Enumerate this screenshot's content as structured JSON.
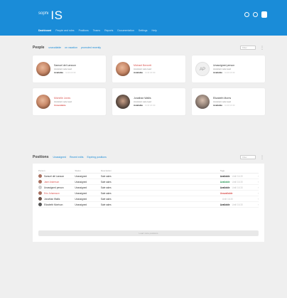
{
  "app": {
    "brand_prefix": "sophi",
    "brand_name": "IS"
  },
  "nav": [
    {
      "label": "Dashboard",
      "active": true
    },
    {
      "label": "People and roles",
      "active": false
    },
    {
      "label": "Positions",
      "active": false
    },
    {
      "label": "Teams",
      "active": false
    },
    {
      "label": "Reports",
      "active": false
    },
    {
      "label": "Documentation",
      "active": false
    },
    {
      "label": "Settings",
      "active": false
    },
    {
      "label": "Help",
      "active": false
    }
  ],
  "people": {
    "title": "People",
    "filters": [
      "unavailable",
      "on vacation",
      "promoted recently"
    ],
    "search_placeholder": "Filter",
    "more": "⋮",
    "cards": [
      {
        "name": "Samuel del Larsson",
        "sub": "Assistant sale lead",
        "status": "Available",
        "status_light": "Until 16:30",
        "pic": "photo",
        "name_color": "normal"
      },
      {
        "name": "Michael Bennett",
        "sub": "Assistant sale lead",
        "status": "Available",
        "status_light": "Until 16:30",
        "pic": "photo",
        "name_color": "red"
      },
      {
        "name": "Unassigned person",
        "sub": "Assistant sale lead",
        "status": "Available",
        "status_light": "Until 16:30",
        "pic": "initials",
        "initials": "AP",
        "name_color": "normal"
      },
      {
        "name": "Michelle Jones",
        "sub": "Assistant sale lead",
        "status": "Unavailable",
        "status_light": "",
        "pic": "photo",
        "name_color": "red",
        "status_color": "red"
      },
      {
        "name": "Jonathan Wallis",
        "sub": "Assistant sale lead",
        "status": "Available",
        "status_light": "Until 16:30",
        "pic": "photo-dark",
        "name_color": "normal"
      },
      {
        "name": "Elizabeth Morris",
        "sub": "Assistant sale lead",
        "status": "Available",
        "status_light": "Until 16:30",
        "pic": "photo-gray",
        "name_color": "normal"
      }
    ]
  },
  "positions": {
    "title": "Positions",
    "filters": [
      "Unassigned",
      "Recent edits",
      "Expiring positions"
    ],
    "search_placeholder": "Filter",
    "more": "⋮",
    "headers": [
      "Person",
      "Status",
      "Description",
      "Tags",
      ""
    ],
    "rows": [
      {
        "person": "Samuel del Larsson",
        "status": "Unassigned",
        "desc": "Sale sales",
        "tags": [
          "Available",
          "Until 16:30"
        ],
        "tag_color": "normal",
        "red": false
      },
      {
        "person": "Jane Anderson",
        "status": "Unassigned",
        "desc": "Sale sales",
        "tags": [
          "Available",
          "Until 16:30"
        ],
        "tag_color": "green",
        "red": true
      },
      {
        "person": "Unassigned person",
        "status": "Unassigned",
        "desc": "Sale sales",
        "tags": [
          "Available",
          "Until 16:30"
        ],
        "tag_color": "normal",
        "red": false
      },
      {
        "person": "Eric Johansson",
        "status": "Unassigned",
        "desc": "Sale sales",
        "tags": [
          "Unavailable",
          ""
        ],
        "tag_color": "red",
        "red": true
      },
      {
        "person": "Jonathan Wallis",
        "status": "Unassigned",
        "desc": "Sale sales",
        "tags": [
          "",
          "Until 16:30"
        ],
        "tag_color": "normal",
        "red": false
      },
      {
        "person": "Elizabeth Morrison",
        "status": "Unassigned",
        "desc": "Sale sales",
        "tags": [
          "Available",
          "Until 16:30"
        ],
        "tag_color": "normal",
        "red": false
      }
    ],
    "load_more": "Load more positions"
  }
}
